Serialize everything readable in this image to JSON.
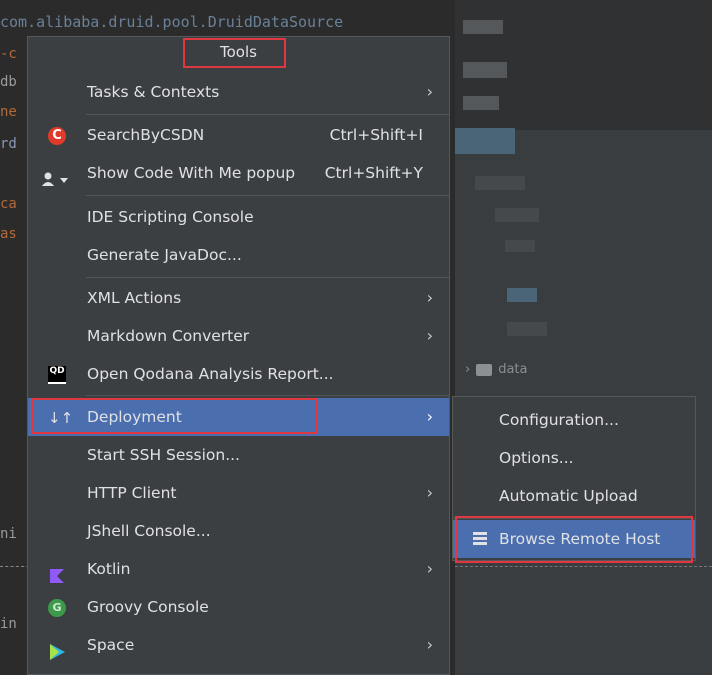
{
  "editor": {
    "code_line": "com.alibaba.druid.pool.DruidDataSource",
    "folder_label": "data"
  },
  "menu": {
    "title": "Tools",
    "items": [
      {
        "label": "Tasks & Contexts",
        "has_submenu": true
      },
      {
        "label": "SearchByCSDN",
        "shortcut": "Ctrl+Shift+I",
        "icon": "csdn-icon"
      },
      {
        "label": "Show Code With Me popup",
        "shortcut": "Ctrl+Shift+Y",
        "icon": "code-with-me-icon"
      },
      {
        "label": "IDE Scripting Console"
      },
      {
        "label": "Generate JavaDoc..."
      },
      {
        "label": "XML Actions",
        "has_submenu": true
      },
      {
        "label": "Markdown Converter",
        "has_submenu": true
      },
      {
        "label": "Open Qodana Analysis Report...",
        "icon": "qodana-icon"
      },
      {
        "label": "Deployment",
        "has_submenu": true,
        "selected": true,
        "icon": "deployment-icon"
      },
      {
        "label": "Start SSH Session..."
      },
      {
        "label": "HTTP Client",
        "has_submenu": true
      },
      {
        "label": "JShell Console..."
      },
      {
        "label": "Kotlin",
        "has_submenu": true,
        "icon": "kotlin-icon"
      },
      {
        "label": "Groovy Console",
        "icon": "groovy-icon"
      },
      {
        "label": "Space",
        "has_submenu": true,
        "icon": "space-icon"
      }
    ]
  },
  "submenu": {
    "items": [
      {
        "label": "Configuration..."
      },
      {
        "label": "Options..."
      },
      {
        "label": "Automatic Upload"
      },
      {
        "label": "Browse Remote Host",
        "selected": true,
        "icon": "remote-host-icon"
      }
    ]
  },
  "arrow_glyph": "›",
  "colors": {
    "menu_bg": "#3c3f41",
    "selection": "#4b6eaf",
    "highlight_box": "#e0383e",
    "text": "#dfe1e5"
  }
}
